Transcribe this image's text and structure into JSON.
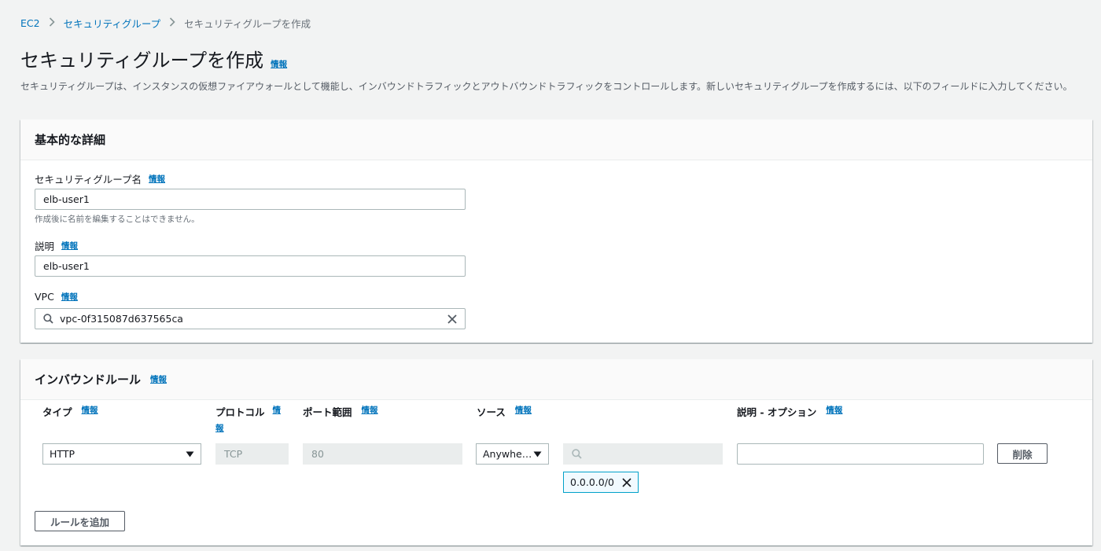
{
  "breadcrumb": {
    "items": [
      "EC2",
      "セキュリティグループ"
    ],
    "current": "セキュリティグループを作成"
  },
  "page": {
    "title": "セキュリティグループを作成",
    "info_label": "情報",
    "description": "セキュリティグループは、インスタンスの仮想ファイアウォールとして機能し、インバウンドトラフィックとアウトバウンドトラフィックをコントロールします。新しいセキュリティグループを作成するには、以下のフィールドに入力してください。"
  },
  "basic": {
    "heading": "基本的な詳細",
    "name_label": "セキュリティグループ名",
    "name_value": "elb-user1",
    "name_hint": "作成後に名前を編集することはできません。",
    "desc_label": "説明",
    "desc_value": "elb-user1",
    "vpc_label": "VPC",
    "vpc_value": "vpc-0f315087d637565ca"
  },
  "inbound": {
    "heading": "インバウンドルール",
    "columns": {
      "type": "タイプ",
      "protocol": "プロトコル",
      "port": "ポート範囲",
      "source": "ソース",
      "description": "説明 - オプション"
    },
    "protocol_info_1": "情",
    "protocol_info_2": "報",
    "rule": {
      "type": "HTTP",
      "protocol": "TCP",
      "port": "80",
      "source": "Anywhe…",
      "cidr": "0.0.0.0/0",
      "description": ""
    },
    "delete_label": "削除",
    "add_rule_label": "ルールを追加"
  },
  "icons": {
    "search": "search-icon",
    "clear": "close-icon",
    "dropdown": "caret-down-icon",
    "breadcrumb_sep": "chevron-right-icon"
  },
  "colors": {
    "link": "#0073bb",
    "background": "#f2f3f3",
    "token_border": "#00a1c9"
  }
}
